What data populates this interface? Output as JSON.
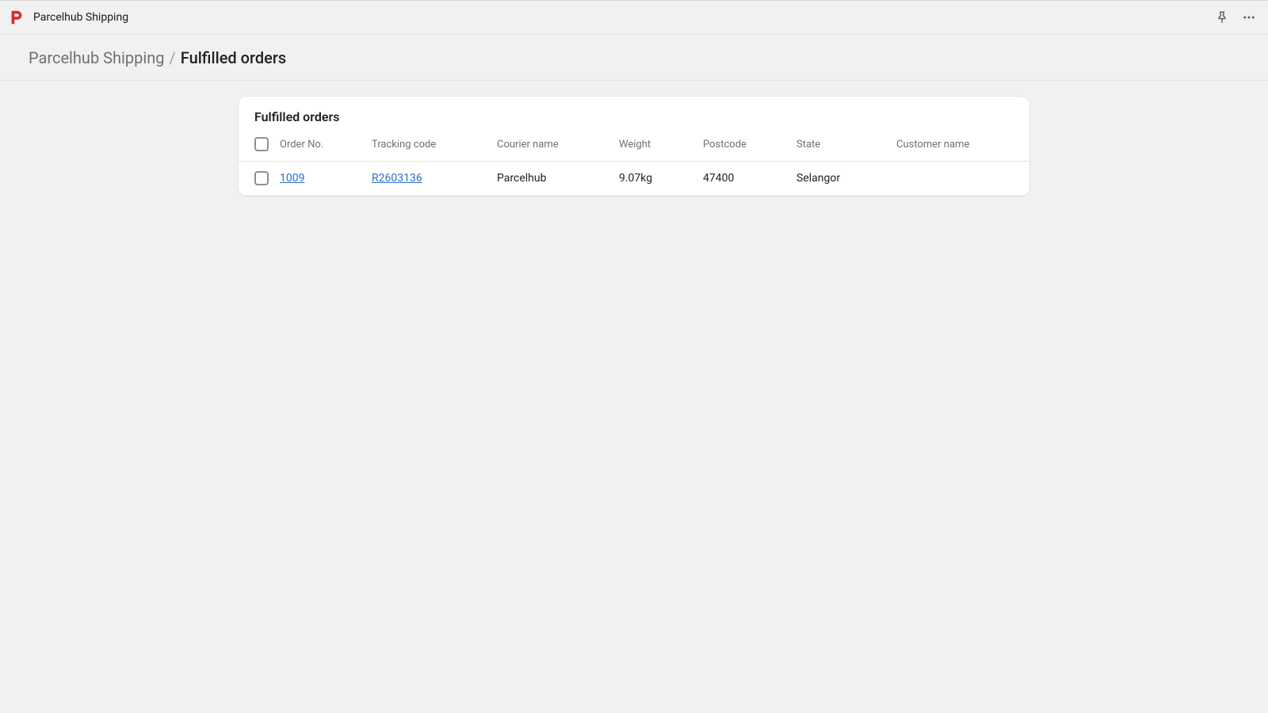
{
  "topbar": {
    "app_name": "Parcelhub Shipping"
  },
  "breadcrumb": {
    "root": "Parcelhub Shipping",
    "separator": "/",
    "current": "Fulfilled orders"
  },
  "card": {
    "title": "Fulfilled orders"
  },
  "table": {
    "headers": {
      "order_no": "Order No.",
      "tracking": "Tracking code",
      "courier": "Courier name",
      "weight": "Weight",
      "postcode": "Postcode",
      "state": "State",
      "customer": "Customer name"
    },
    "rows": [
      {
        "order_no": "1009",
        "tracking": "R2603136",
        "courier": "Parcelhub",
        "weight": "9.07kg",
        "postcode": "47400",
        "state": "Selangor",
        "customer": ""
      }
    ]
  },
  "colors": {
    "link": "#2c6ecb",
    "brand": "#d82c2c"
  }
}
